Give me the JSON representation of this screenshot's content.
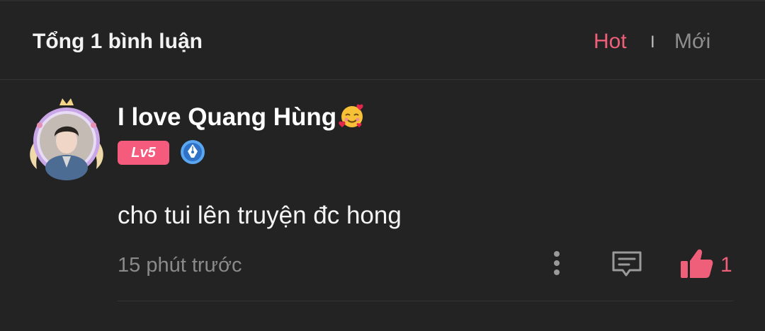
{
  "header": {
    "title": "Tổng 1 bình luận",
    "sort_options": [
      "Hot",
      "Mới"
    ],
    "separator": "I",
    "active_sort": "Hot"
  },
  "comment": {
    "username": "I love Quang Hùng",
    "username_emoji": "smiling-face-with-hearts",
    "level_badge": "Lv5",
    "badge_icon": "pen-nib-badge-icon",
    "text": "cho tui lên truyện đc hong",
    "time": "15 phút trước",
    "like_count": "1"
  },
  "colors": {
    "background": "#232323",
    "accent": "#ef5f79",
    "muted": "#8a8a8a"
  }
}
